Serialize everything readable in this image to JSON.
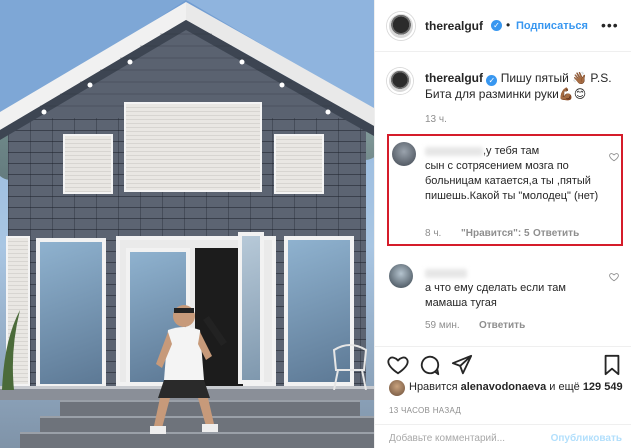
{
  "post": {
    "username": "therealguf",
    "follow_label": "Подписаться",
    "more_label": "•••",
    "separator": "•",
    "caption_text": "Пишу пятый 👋🏾 P.S. Бита для разминки руки💪🏾😊",
    "caption_time": "13 ч."
  },
  "comments": [
    {
      "text_line1": ",у тебя там",
      "text_rest": "сын с сотрясением мозга по больницам катается,а ты ,пятый пишешь.Какой ты \"молодец\" (нет)",
      "time": "8 ч.",
      "likes": "\"Нравится\": 5",
      "reply": "Ответить",
      "highlighted": true
    },
    {
      "text": "а что ему сделать если там мамаша тугая",
      "time": "59 мин.",
      "reply": "Ответить",
      "highlighted": false
    }
  ],
  "footer": {
    "liked_by_prefix": "Нравится ",
    "liked_by_user": "alenavodonaeva",
    "liked_by_mid": " и ещё ",
    "liked_count": "129 549",
    "time_ago": "13 ЧАСОВ НАЗАД",
    "add_comment_placeholder": "Добавьте комментарий...",
    "publish_label": "Опубликовать"
  },
  "colors": {
    "accent": "#3897f0",
    "highlight_border": "#d51c2a",
    "muted": "#8e8e8e"
  },
  "icons": [
    "verified-badge-icon",
    "more-options-icon",
    "heart-icon",
    "comment-icon",
    "share-icon",
    "bookmark-icon"
  ]
}
